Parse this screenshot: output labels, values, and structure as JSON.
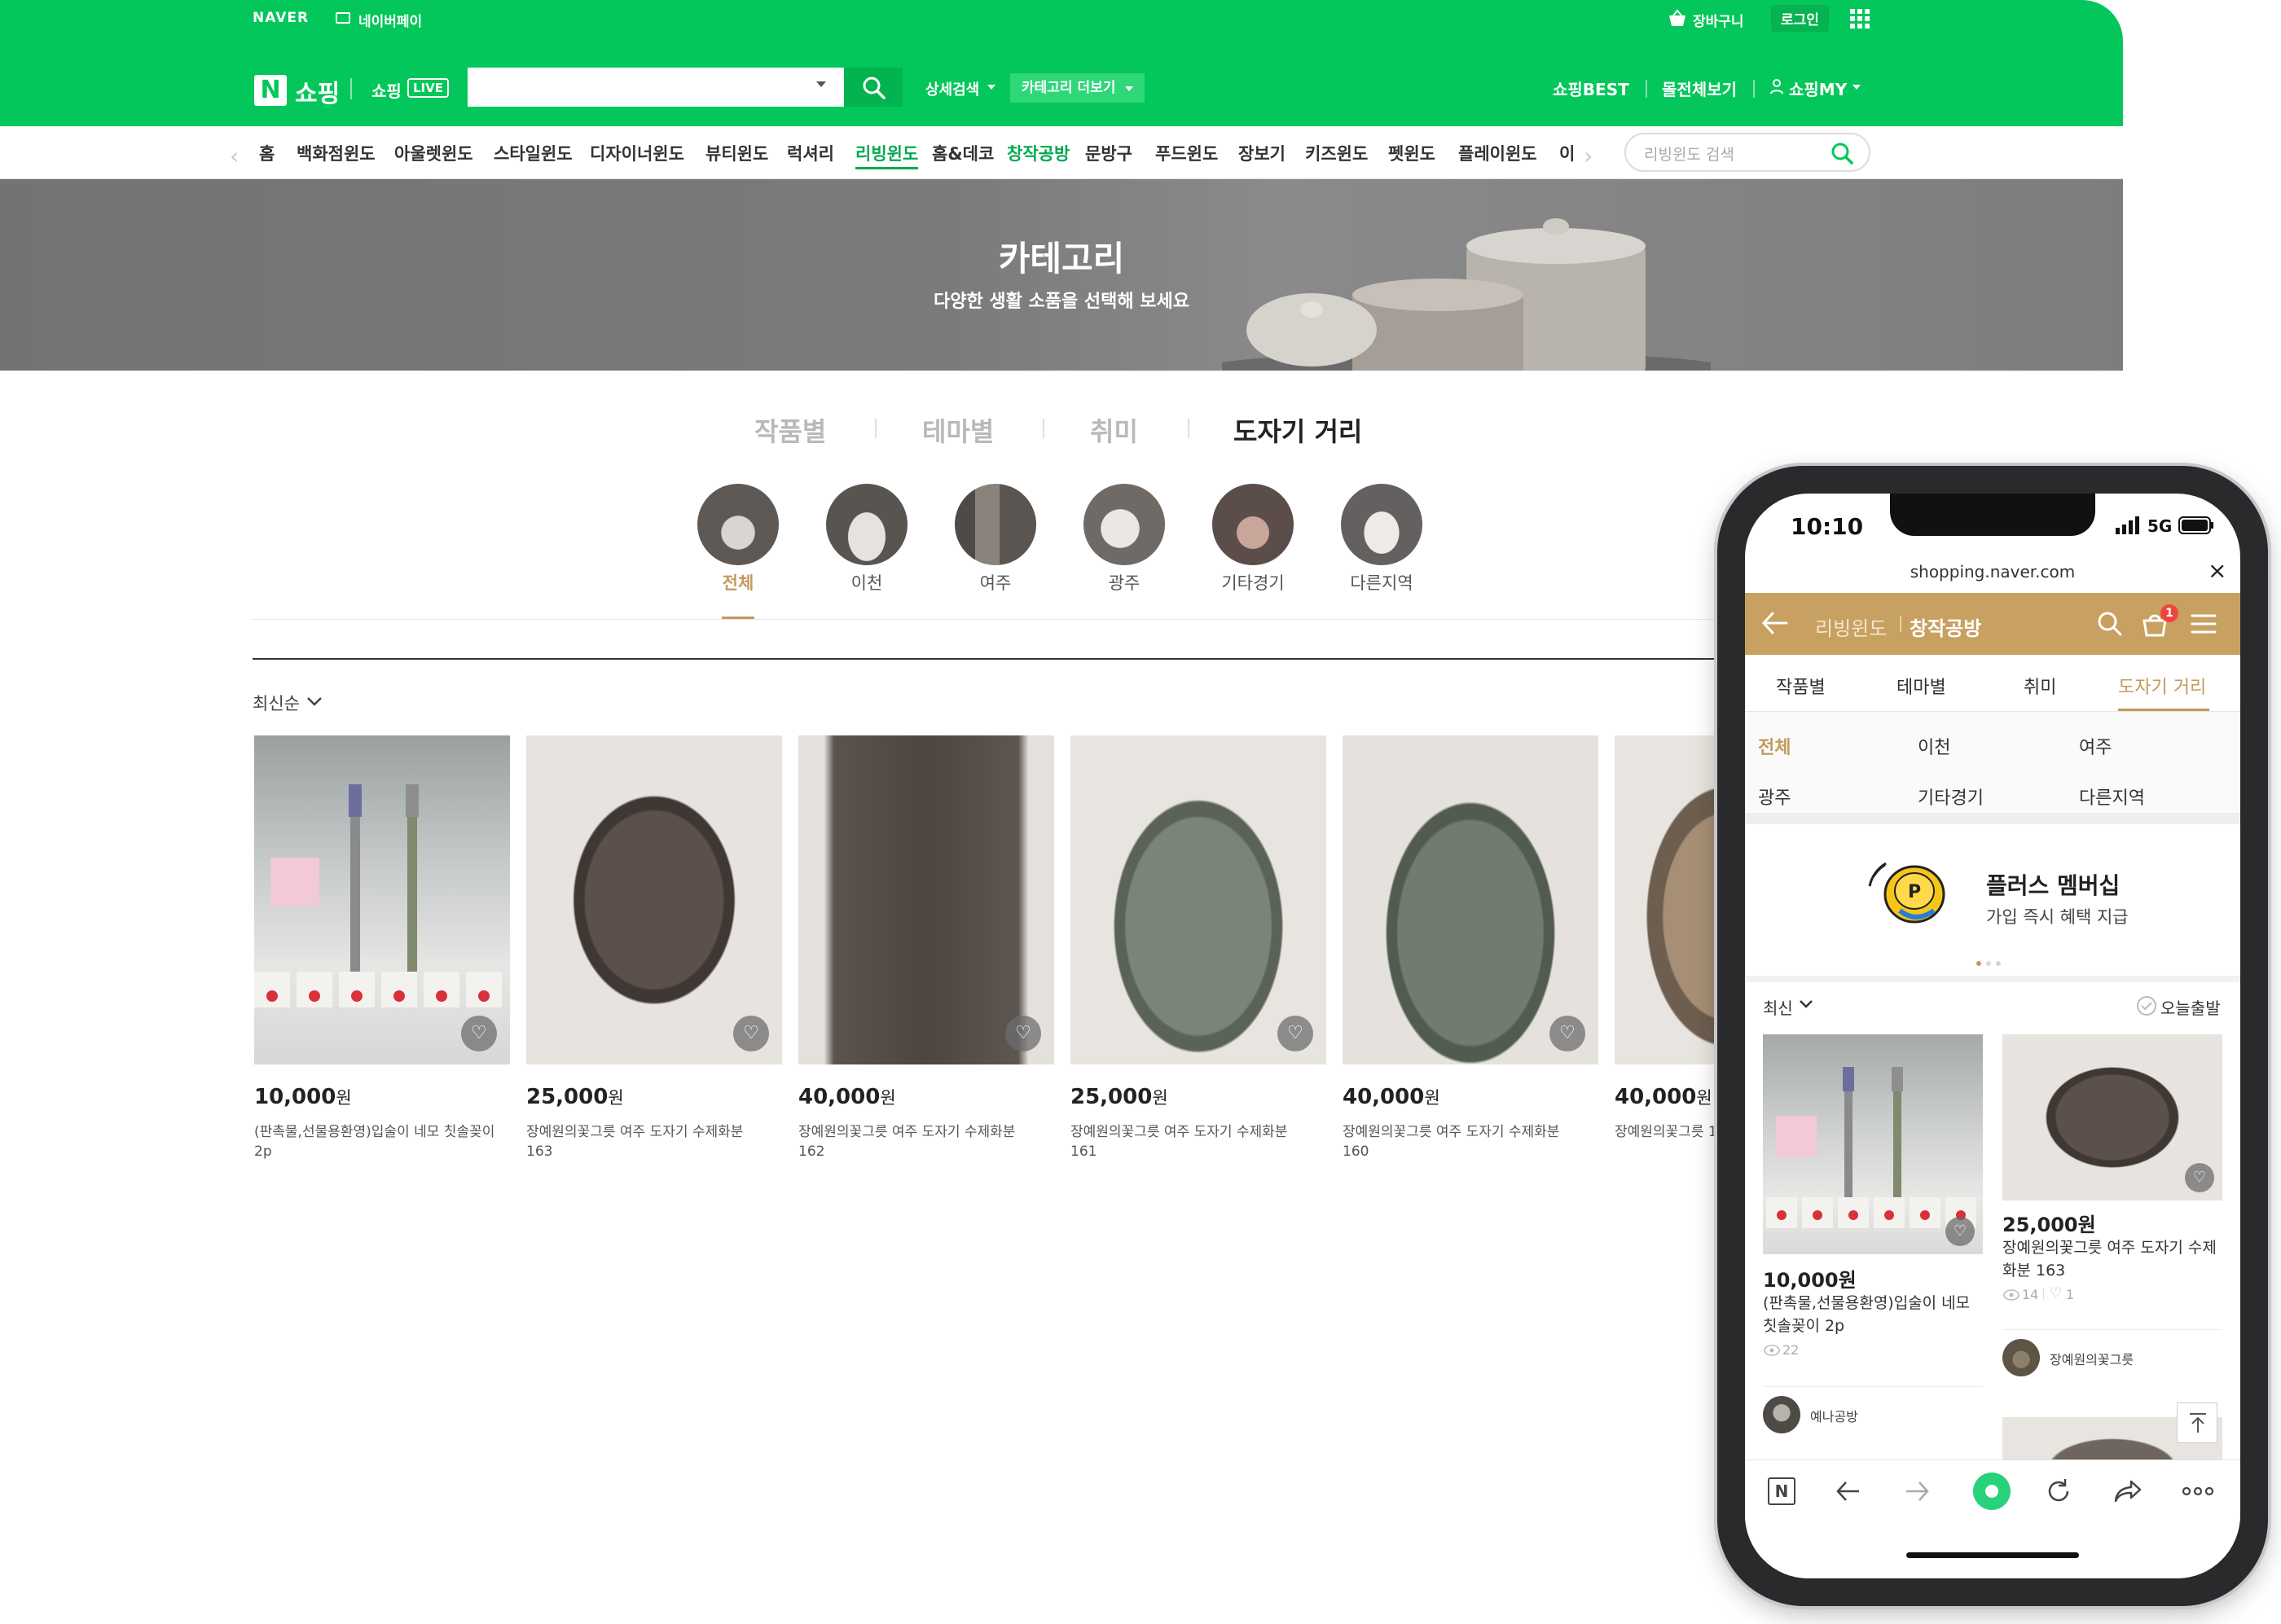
{
  "gnb": {
    "naver": "NAVER",
    "naverpay": "네이버페이",
    "cart": "장바구니",
    "login": "로그인",
    "logo_n": "N",
    "shopping": "쇼핑",
    "shopping_live": "쇼핑",
    "live_badge": "LIVE",
    "detail_search": "상세검색",
    "category_more": "카테고리 더보기",
    "best": "쇼핑BEST",
    "all_mall": "몰전체보기",
    "my": "쇼핑MY"
  },
  "category_nav": {
    "items": [
      "홈",
      "백화점윈도",
      "아울렛윈도",
      "스타일윈도",
      "디자이너윈도",
      "뷰티윈도",
      "럭셔리",
      "리빙윈도",
      "홈&데코",
      "창작공방",
      "문방구",
      "푸드윈도",
      "장보기",
      "키즈윈도",
      "펫윈도",
      "플레이윈도",
      "이"
    ],
    "search_placeholder": "리빙윈도 검색"
  },
  "banner": {
    "title": "카테고리",
    "subtitle": "다양한 생활 소품을 선택해 보세요"
  },
  "tabs": [
    "작품별",
    "테마별",
    "취미",
    "도자기 거리"
  ],
  "regions": [
    "전체",
    "이천",
    "여주",
    "광주",
    "기타경기",
    "다른지역"
  ],
  "sort": "최신순",
  "products": [
    {
      "price": "10,000",
      "won": "원",
      "name": "(판촉물,선물용환영)입술이 네모 칫솔꽂이 2p"
    },
    {
      "price": "25,000",
      "won": "원",
      "name": "장예원의꽃그릇 여주 도자기 수제화분 163"
    },
    {
      "price": "40,000",
      "won": "원",
      "name": "장예원의꽃그릇 여주 도자기 수제화분 162"
    },
    {
      "price": "25,000",
      "won": "원",
      "name": "장예원의꽃그릇 여주 도자기 수제화분 161"
    },
    {
      "price": "40,000",
      "won": "원",
      "name": "장예원의꽃그릇 여주 도자기 수제화분 160"
    },
    {
      "price": "40,000",
      "won": "원",
      "name": "장예원의꽃그릇 159"
    }
  ],
  "phone": {
    "time": "10:10",
    "network": "5G",
    "url": "shopping.naver.com",
    "crumb1": "리빙윈도",
    "crumb2": "창작공방",
    "cart_count": "1",
    "tabs": [
      "작품별",
      "테마별",
      "취미",
      "도자기 거리"
    ],
    "regions": [
      "전체",
      "이천",
      "여주",
      "광주",
      "기타경기",
      "다른지역"
    ],
    "promo_title": "플러스 멤버십",
    "promo_sub": "가입 즉시 혜택 지급",
    "sort": "최신",
    "today_ship": "오늘출발",
    "items": [
      {
        "price": "10,000원",
        "name": "(판촉물,선물용환영)입술이 네모 칫솔꽂이 2p",
        "views": "22",
        "seller": "예나공방"
      },
      {
        "price": "25,000원",
        "name": "장예원의꽃그릇 여주 도자기 수제화분 163",
        "views": "14",
        "likes": "1",
        "seller": "장예원의꽃그릇"
      }
    ]
  },
  "colors": {
    "naver_green": "#03c75a",
    "gold": "#c39a5c",
    "tab_accent": "#c8a061"
  }
}
